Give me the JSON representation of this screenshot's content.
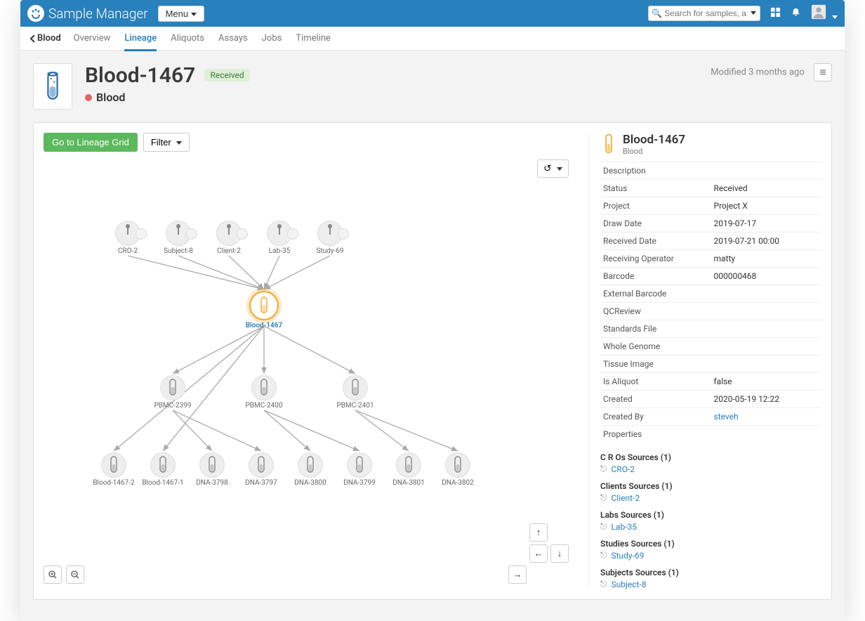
{
  "brand": "Sample Manager",
  "menu_label": "Menu",
  "search_placeholder": "Search for samples, assays, ...",
  "tab_back_label": "Blood",
  "tabs": [
    "Overview",
    "Lineage",
    "Aliquots",
    "Assays",
    "Jobs",
    "Timeline"
  ],
  "active_tab": "Lineage",
  "page": {
    "title": "Blood-1467",
    "status_badge": "Received",
    "type_label": "Blood",
    "modified_label": "Modified 3 months ago"
  },
  "toolbar": {
    "go_grid": "Go to Lineage Grid",
    "filter": "Filter"
  },
  "graph": {
    "sources": [
      {
        "id": "CRO-2"
      },
      {
        "id": "Subject-8"
      },
      {
        "id": "Client-2"
      },
      {
        "id": "Lab-35"
      },
      {
        "id": "Study-69"
      }
    ],
    "center": {
      "id": "Blood-1467"
    },
    "mid": [
      {
        "id": "PBMC-2399"
      },
      {
        "id": "PBMC-2400"
      },
      {
        "id": "PBMC-2401"
      }
    ],
    "leaves": [
      {
        "id": "Blood-1467-2"
      },
      {
        "id": "Blood-1467-1"
      },
      {
        "id": "DNA-3798"
      },
      {
        "id": "DNA-3797"
      },
      {
        "id": "DNA-3800"
      },
      {
        "id": "DNA-3799"
      },
      {
        "id": "DNA-3801"
      },
      {
        "id": "DNA-3802"
      }
    ]
  },
  "detail": {
    "title": "Blood-1467",
    "subtitle": "Blood",
    "rows": [
      {
        "k": "Description",
        "v": ""
      },
      {
        "k": "Status",
        "v": "Received"
      },
      {
        "k": "Project",
        "v": "Project X"
      },
      {
        "k": "Draw Date",
        "v": "2019-07-17"
      },
      {
        "k": "Received Date",
        "v": "2019-07-21 00:00"
      },
      {
        "k": "Receiving Operator",
        "v": "matty"
      },
      {
        "k": "Barcode",
        "v": "000000468"
      },
      {
        "k": "External Barcode",
        "v": ""
      },
      {
        "k": "QCReview",
        "v": ""
      },
      {
        "k": "Standards File",
        "v": ""
      },
      {
        "k": "Whole Genome",
        "v": ""
      },
      {
        "k": "Tissue Image",
        "v": ""
      },
      {
        "k": "Is Aliquot",
        "v": "false"
      },
      {
        "k": "Created",
        "v": "2020-05-19 12:22"
      },
      {
        "k": "Created By",
        "v": "steveh",
        "link": true
      },
      {
        "k": "Properties",
        "v": ""
      }
    ],
    "sources": [
      {
        "title": "C R Os Sources",
        "count": 1,
        "name": "CRO-2"
      },
      {
        "title": "Clients Sources",
        "count": 1,
        "name": "Client-2"
      },
      {
        "title": "Labs Sources",
        "count": 1,
        "name": "Lab-35"
      },
      {
        "title": "Studies Sources",
        "count": 1,
        "name": "Study-69"
      },
      {
        "title": "Subjects Sources",
        "count": 1,
        "name": "Subject-8"
      }
    ]
  }
}
